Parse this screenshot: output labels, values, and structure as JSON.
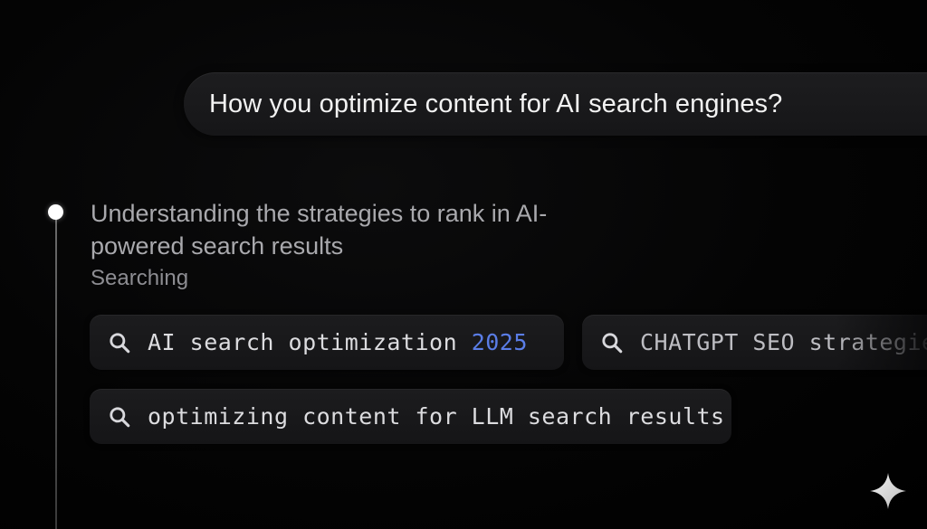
{
  "conversation": {
    "user_query": "How you optimize content for AI search engines?"
  },
  "step": {
    "title": "Understanding the strategies to rank in AI-powered search results",
    "status": "Searching"
  },
  "searches": [
    {
      "text": "AI search optimization ",
      "highlight": "2025",
      "icon": "search-icon"
    },
    {
      "text": "CHATGPT SEO strategies",
      "highlight": "",
      "icon": "search-icon"
    },
    {
      "text": "optimizing content for LLM search results",
      "highlight": "",
      "icon": "search-icon"
    }
  ],
  "colors": {
    "background": "#000000",
    "chip_background": "#1a1a1c",
    "highlight": "#5a7de6",
    "muted_text": "#a9a9ad"
  },
  "footer": {
    "icon": "sparkle-icon"
  }
}
